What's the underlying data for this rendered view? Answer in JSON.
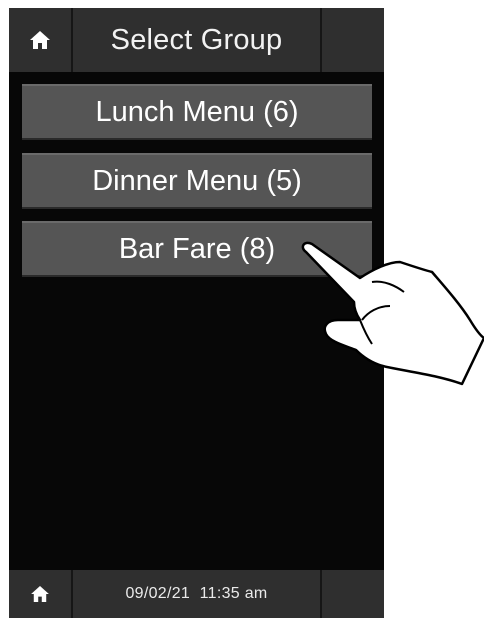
{
  "header": {
    "title": "Select Group"
  },
  "menu": {
    "items": [
      {
        "label": "Lunch Menu (6)"
      },
      {
        "label": "Dinner Menu (5)"
      },
      {
        "label": "Bar Fare (8)"
      }
    ]
  },
  "footer": {
    "datetime": "09/02/21  11:35 am"
  },
  "icons": {
    "home": "home-icon",
    "pointer": "pointing-hand-icon"
  },
  "colors": {
    "screen_bg": "#070707",
    "bar_bg": "#2f2f2f",
    "button_bg": "#555555",
    "text": "#ffffff"
  }
}
